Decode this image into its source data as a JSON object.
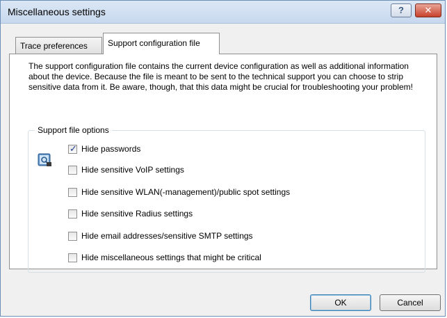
{
  "window": {
    "title": "Miscellaneous settings",
    "help_glyph": "?",
    "close_glyph": "✕"
  },
  "tabs": [
    {
      "label": "Trace preferences",
      "selected": false
    },
    {
      "label": "Support configuration file",
      "selected": true
    }
  ],
  "support": {
    "description": "The support configuration file contains the current device configuration as well as additional information about the device. Because the file is meant to be sent to the technical support you can choose to strip sensitive data from it. Be aware, though, that this data might be crucial for troubleshooting your problem!",
    "group_label": "Support file options",
    "icon": "config-file-icon",
    "options": [
      {
        "label": "Hide passwords",
        "checked": true
      },
      {
        "label": "Hide sensitive VoIP settings",
        "checked": false
      },
      {
        "label": "Hide sensitive WLAN(-management)/public spot settings",
        "checked": false
      },
      {
        "label": "Hide sensitive Radius settings",
        "checked": false
      },
      {
        "label": "Hide email addresses/sensitive SMTP settings",
        "checked": false
      },
      {
        "label": "Hide miscellaneous settings that might be critical",
        "checked": false
      }
    ]
  },
  "buttons": {
    "ok": "OK",
    "cancel": "Cancel"
  },
  "colors": {
    "accent": "#3c7fb1",
    "close": "#c7412b"
  }
}
